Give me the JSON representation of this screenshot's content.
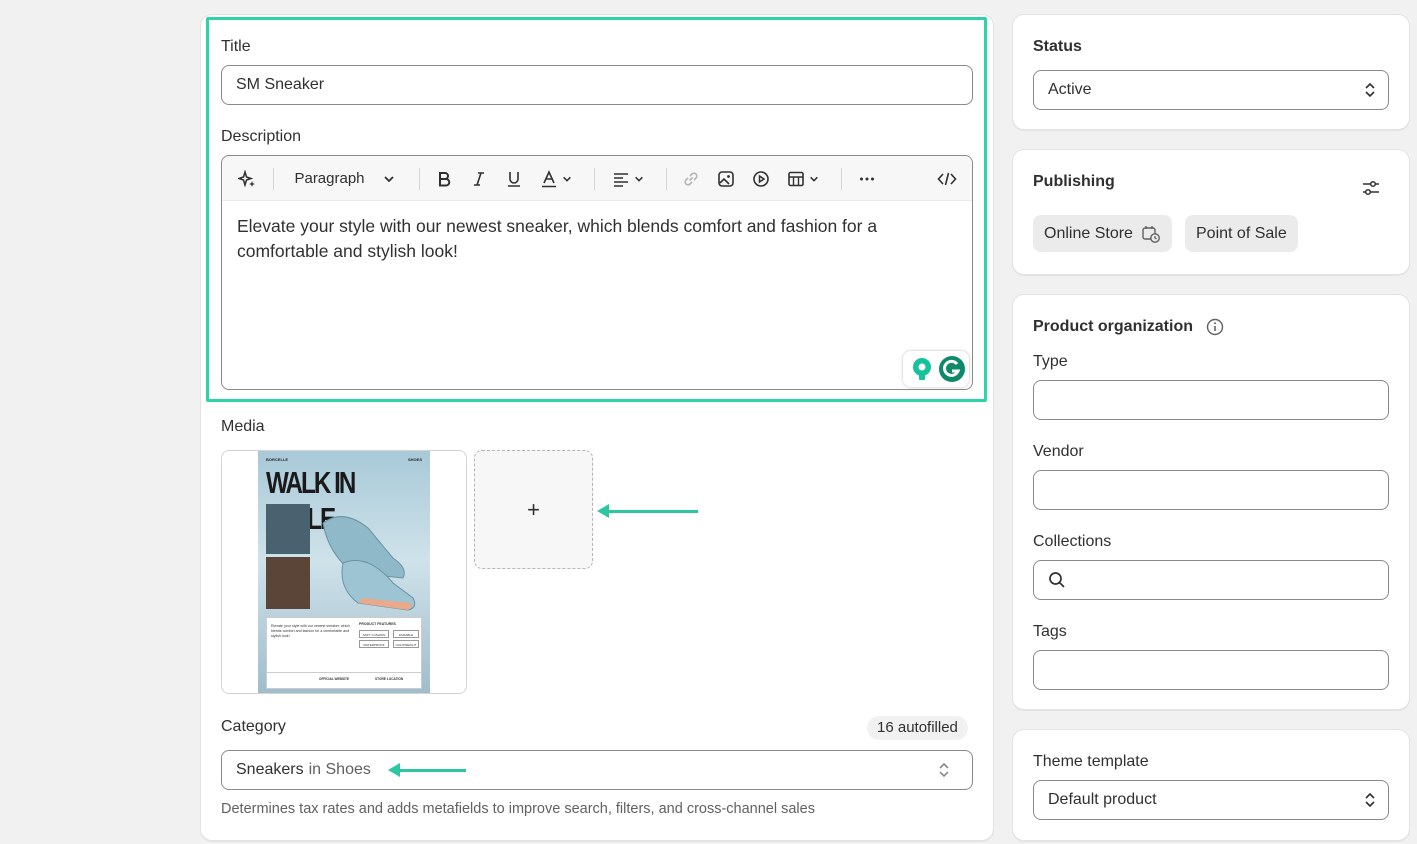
{
  "product": {
    "title_label": "Title",
    "title_value": "SM Sneaker",
    "description_label": "Description",
    "toolbar": {
      "paragraph": "Paragraph"
    },
    "description_text": "Elevate your style with our newest sneaker, which blends comfort and fashion for a comfortable and stylish look!",
    "media_label": "Media",
    "media_image": {
      "brand": "BORCELLE",
      "tag": "SHOES",
      "headline": "WALK IN STYLE",
      "blurb": "Elevate your style with our newest sneaker, which blends comfort and fashion for a comfortable and stylish look!",
      "features_title": "PRODUCT FEATURES",
      "features": [
        "SOFT CUSHION",
        "DURABLE",
        "LIGHTWEIGHT",
        "WATERPROOF"
      ],
      "footer_left": "OFFICIAL WEBSITE",
      "footer_right": "STORE LOCATION"
    },
    "add_media_symbol": "+",
    "category_label": "Category",
    "autofilled_badge": "16 autofilled",
    "category_value": "Sneakers",
    "category_parent": "in Shoes",
    "category_help": "Determines tax rates and adds metafields to improve search, filters, and cross-channel sales"
  },
  "status": {
    "label": "Status",
    "value": "Active"
  },
  "publishing": {
    "label": "Publishing",
    "channels": [
      "Online Store",
      "Point of Sale"
    ]
  },
  "organization": {
    "label": "Product organization",
    "type_label": "Type",
    "vendor_label": "Vendor",
    "collections_label": "Collections",
    "tags_label": "Tags"
  },
  "theme": {
    "label": "Theme template",
    "value": "Default product"
  },
  "colors": {
    "highlight": "#2dd4a7",
    "grammarly": "#15c39a"
  }
}
